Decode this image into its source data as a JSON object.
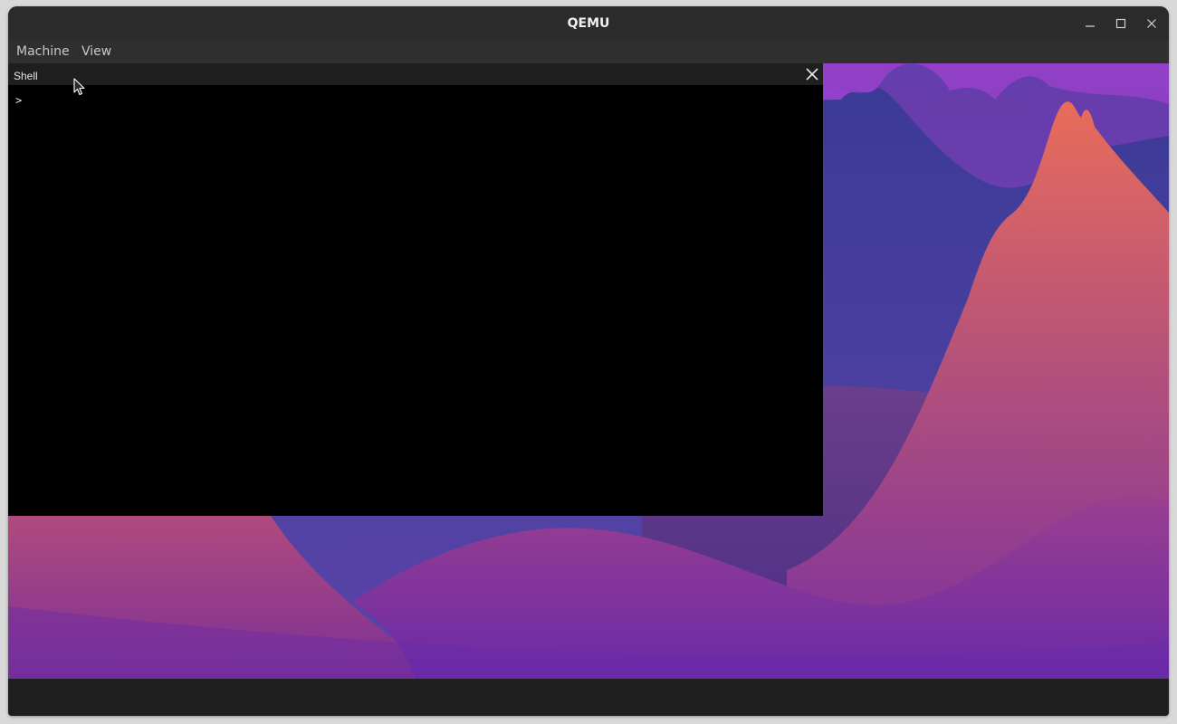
{
  "window": {
    "title": "QEMU"
  },
  "menubar": {
    "items": [
      {
        "label": "Machine"
      },
      {
        "label": "View"
      }
    ]
  },
  "shell": {
    "title": "Shell",
    "prompt": ">"
  },
  "colors": {
    "titlebar": "#2b2b2b",
    "menubar": "#2f2f2f",
    "shell_background": "#000000",
    "wallpaper_sky_top": "#a74fd6",
    "wallpaper_peak": "#e06b5e",
    "wallpaper_ground": "#6a2aa8"
  },
  "icons": {
    "minimize": "minimize-icon",
    "maximize": "maximize-icon",
    "close": "close-icon",
    "shell_close": "close-icon",
    "mouse_cursor": "mouse-pointer-icon"
  }
}
